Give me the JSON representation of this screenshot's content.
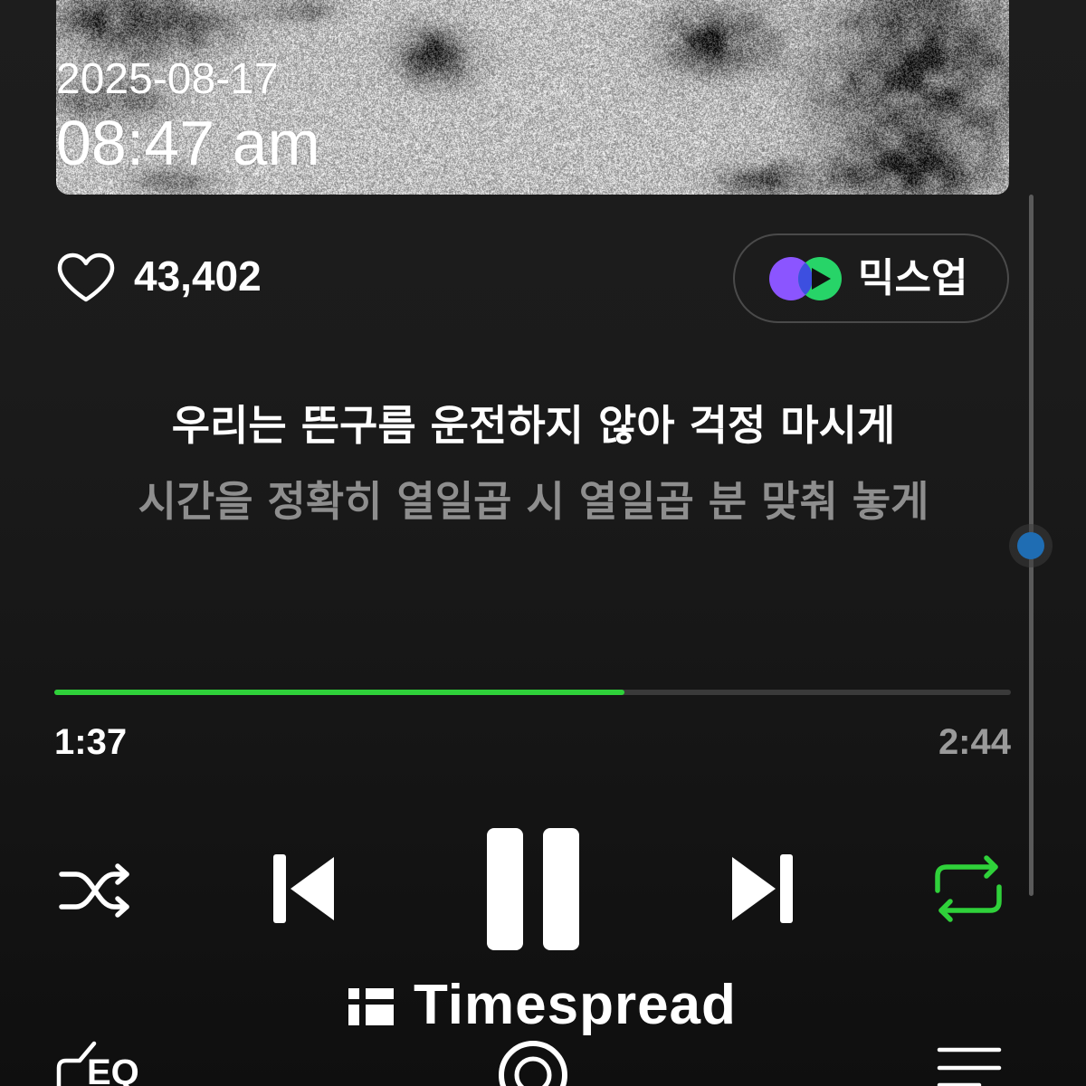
{
  "album": {
    "date_stamp": "2025-08-17",
    "time_stamp": "08:47 am"
  },
  "like": {
    "icon": "heart-outline-icon",
    "count": "43,402"
  },
  "mixup": {
    "icon": "mixup-icon",
    "label": "믹스업"
  },
  "lyrics": {
    "current_line": "우리는 뜬구름 운전하지 않아 걱정 마시게",
    "next_line": "시간을 정확히 열일곱 시 열일곱 분 맞춰 놓게"
  },
  "playback": {
    "elapsed": "1:37",
    "duration": "2:44",
    "progress_fraction": 0.596,
    "shuffle_on": false,
    "repeat_on": true
  },
  "controls": {
    "shuffle_icon": "shuffle-icon",
    "previous_icon": "skip-previous-icon",
    "play_pause_icon": "pause-icon",
    "next_icon": "skip-next-icon",
    "repeat_icon": "repeat-icon"
  },
  "scroll": {
    "fraction": 0.5
  },
  "watermark": {
    "icon": "timespread-logo-icon",
    "text": "Timespread"
  },
  "bottom_bar": {
    "eq_icon": "eq-icon",
    "eq_label": "EQ",
    "center_icon": "lens-icon",
    "queue_icon": "playlist-icon"
  },
  "colors": {
    "background": "#141414",
    "text_primary": "#ffffff",
    "secondary_text": "#8e8e8e",
    "time_total": "#9a9a9a",
    "accent_green": "#2fd13a",
    "progress_track": "#3a3a3a",
    "pill_border": "#4a4a4a",
    "scroll_line": "#5a5a5a",
    "scroll_thumb": "#1f6db3",
    "mixup_purple": "#8b55ff",
    "mixup_overlap": "#3d4fe0",
    "mixup_green": "#27d468",
    "mixup_play": "#111111"
  }
}
